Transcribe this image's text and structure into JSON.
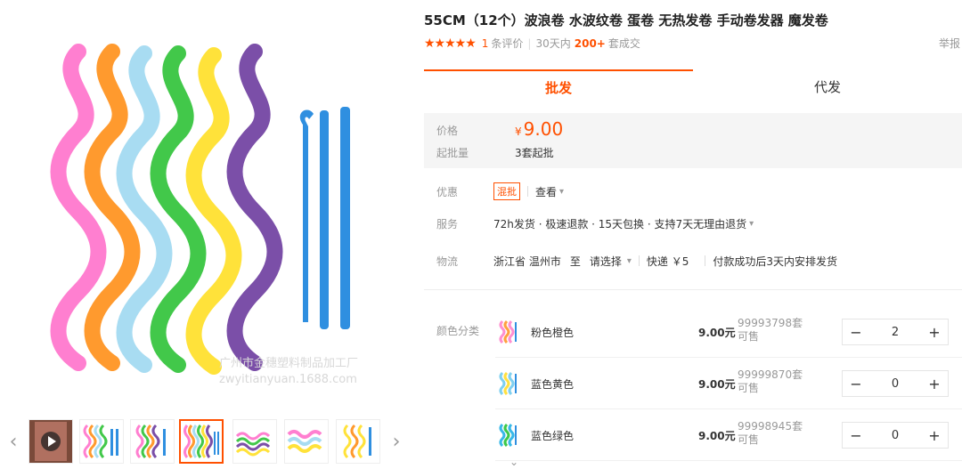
{
  "product": {
    "title": "55CM（12个）波浪卷 水波纹卷 蛋卷 无热发卷 手动卷发器 魔发卷",
    "report_label": "举报",
    "rating_stars": "★★★★★",
    "review_count": "1",
    "review_label": "条评价",
    "period_label": "30天内",
    "sold_count": "200+",
    "sold_label": "套成交"
  },
  "gallery": {
    "watermark_line1": "广州市金穗塑料制品加工厂",
    "watermark_line2": "zwyitianyuan.1688.com",
    "prev_arrow": "‹",
    "next_arrow": "›",
    "play_icon": "▶"
  },
  "tabs": [
    {
      "label": "批发",
      "active": true
    },
    {
      "label": "代发",
      "active": false
    }
  ],
  "price": {
    "label": "价格",
    "currency": "¥",
    "value": "9.00",
    "min_label": "起批量",
    "min_value": "3套起批"
  },
  "promo": {
    "label": "优惠",
    "badge": "混批",
    "view": "查看"
  },
  "service": {
    "label": "服务",
    "text": "72h发货 · 极速退款 · 15天包换 · 支持7天无理由退货"
  },
  "logistics": {
    "label": "物流",
    "origin": "浙江省 温州市",
    "to": "至",
    "destination": "请选择",
    "shipping": "快递 ￥5",
    "note": "付款成功后3天内安排发货"
  },
  "sku": {
    "label": "颜色分类",
    "items": [
      {
        "name": "粉色橙色",
        "price": "9.00元",
        "stock_line1": "99993798套",
        "stock_line2": "可售",
        "qty": "2",
        "colors": [
          "#ff8fd0",
          "#ffa040"
        ]
      },
      {
        "name": "蓝色黄色",
        "price": "9.00元",
        "stock_line1": "99999870套",
        "stock_line2": "可售",
        "qty": "0",
        "colors": [
          "#7fd0f0",
          "#ffe040"
        ]
      },
      {
        "name": "蓝色绿色",
        "price": "9.00元",
        "stock_line1": "99998945套",
        "stock_line2": "可售",
        "qty": "0",
        "colors": [
          "#38b8e8",
          "#3cc84a"
        ]
      }
    ],
    "minus": "−",
    "plus": "+",
    "more_icon": "⌄"
  },
  "colors": {
    "accent": "#ff5000",
    "curlers": [
      "#ff7fd0",
      "#ff9a2e",
      "#a8dcf2",
      "#42c84a",
      "#ffe23a",
      "#7b4fa8"
    ],
    "stick": "#2f8fe0"
  }
}
